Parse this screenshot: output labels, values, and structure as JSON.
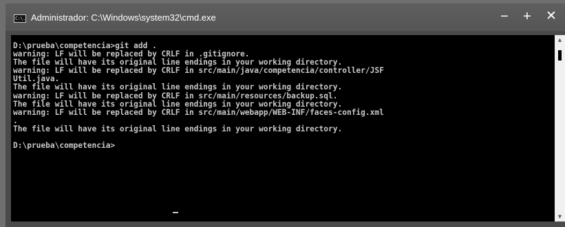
{
  "window": {
    "title": "Administrador: C:\\Windows\\system32\\cmd.exe",
    "icon_label": "C:\\.",
    "icon": "cmd-icon",
    "controls": {
      "minimize": "−",
      "maximize": "+",
      "close": "✕"
    }
  },
  "console": {
    "lines": [
      "D:\\prueba\\competencia>git add .",
      "warning: LF will be replaced by CRLF in .gitignore.",
      "The file will have its original line endings in your working directory.",
      "warning: LF will be replaced by CRLF in src/main/java/competencia/controller/JSF",
      "Util.java.",
      "The file will have its original line endings in your working directory.",
      "warning: LF will be replaced by CRLF in src/main/resources/backup.sql.",
      "The file will have its original line endings in your working directory.",
      "warning: LF will be replaced by CRLF in src/main/webapp/WEB-INF/faces-config.xml",
      ".",
      "The file will have its original line endings in your working directory.",
      "",
      "D:\\prueba\\competencia>"
    ],
    "text_color": "#c8c8c8",
    "background": "#000000"
  },
  "scrollbar": {
    "up_arrow": "▲",
    "down_arrow": "▼"
  }
}
